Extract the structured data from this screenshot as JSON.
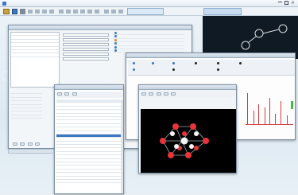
{
  "app": {
    "title_left": "",
    "title_right": ""
  },
  "toolbar": {
    "toggle_label": ""
  },
  "icons": {
    "app_icon": "app-logo-icon",
    "minimize": "minimize-icon",
    "maximize": "maximize-icon",
    "close": "close-icon",
    "folder": "folder-icon",
    "save": "save-icon",
    "cut": "scissors-icon",
    "molecule": "molecule-icon"
  },
  "colors": {
    "accent": "#3b78c2",
    "spectrum": "#d23a3a",
    "canvas": "#0f1a24",
    "atom_red": "#e8343a",
    "atom_white": "#f3f3f3"
  }
}
